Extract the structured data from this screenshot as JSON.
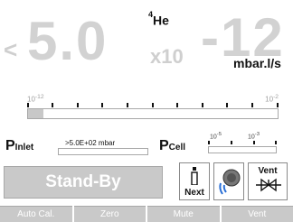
{
  "readout": {
    "trend_symbol": "<",
    "mantissa": "5.0",
    "gas": {
      "mass": "4",
      "symbol": "He"
    },
    "times_ten": "x10",
    "exponent": "-12",
    "unit": "mbar.l/s"
  },
  "scale": {
    "low_label": "-12",
    "high_label": "-2",
    "fill_fraction": 0.06
  },
  "pressure": {
    "inlet_label": "P",
    "inlet_sub": "Inlet",
    "inlet_value": ">5.0E+02 mbar",
    "cell_label": "P",
    "cell_sub": "Cell",
    "cell_low": "-5",
    "cell_high": "-3"
  },
  "status": {
    "text": "Stand-By"
  },
  "buttons": {
    "next_label": "Next",
    "vent_label": "Vent"
  },
  "softkeys": [
    "Auto Cal.",
    "Zero",
    "Mute",
    "Vent"
  ]
}
